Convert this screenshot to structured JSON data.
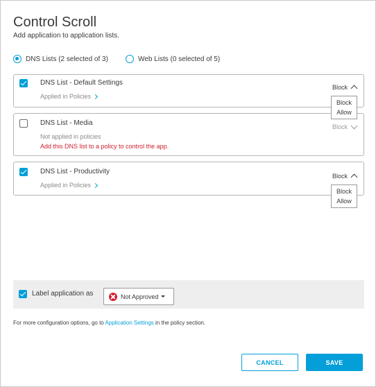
{
  "dialog": {
    "title": "Control Scroll",
    "subtitle": "Add application to application lists."
  },
  "list_type": {
    "dns_label": "DNS Lists (2 selected of 3)",
    "web_label": "Web Lists (0 selected of 5)",
    "selected": "dns"
  },
  "lists": [
    {
      "name": "DNS List - Default Settings",
      "checked": true,
      "status": "Applied in Policies",
      "action": "Block",
      "menu": [
        "Block",
        "Allow"
      ]
    },
    {
      "name": "DNS List - Media",
      "checked": false,
      "status": "Not applied in policies",
      "warning": "Add this DNS list to a policy to control the app.",
      "action": "Block"
    },
    {
      "name": "DNS List - Productivity",
      "checked": true,
      "status": "Applied in Policies",
      "action": "Block",
      "menu": [
        "Block",
        "Allow"
      ]
    }
  ],
  "label_app": {
    "checked": true,
    "label": "Label application as",
    "value": "Not Approved",
    "icon": "x-circle-icon"
  },
  "footer": {
    "prefix": "For more configuration options, go to ",
    "link": "Application Settings",
    "suffix": " in the policy section."
  },
  "buttons": {
    "cancel": "CANCEL",
    "save": "SAVE"
  },
  "colors": {
    "accent": "#049fd9",
    "error": "#cf2030",
    "text": "#39393b"
  }
}
